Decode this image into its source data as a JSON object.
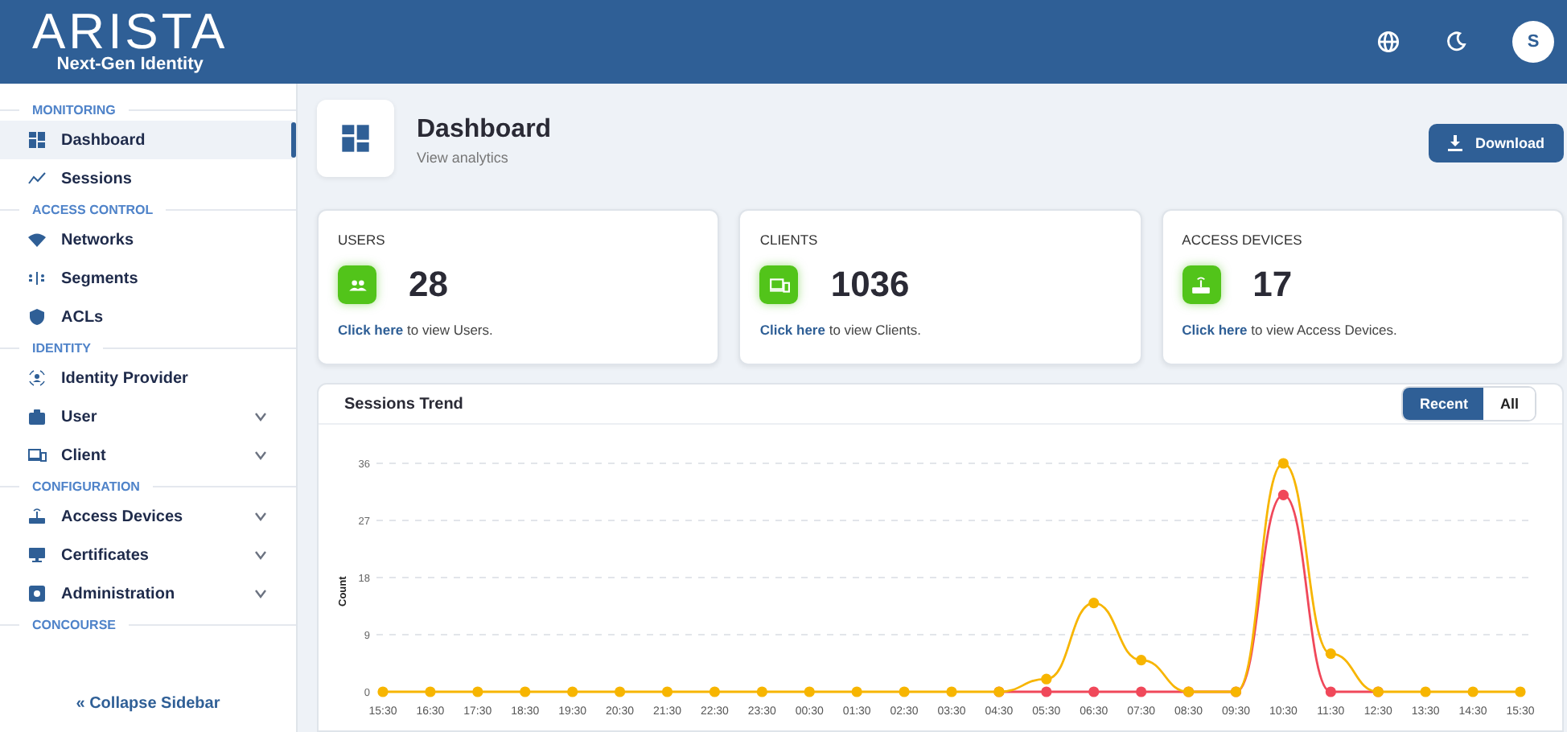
{
  "header": {
    "logo": "ARISTA",
    "tagline": "Next-Gen Identity",
    "avatar": "S"
  },
  "sidebar": {
    "sections": [
      {
        "title": "MONITORING",
        "items": [
          {
            "label": "Dashboard",
            "selected": true
          },
          {
            "label": "Sessions",
            "selected": false
          }
        ]
      },
      {
        "title": "ACCESS CONTROL",
        "items": [
          {
            "label": "Networks",
            "selected": false
          },
          {
            "label": "Segments",
            "selected": false
          },
          {
            "label": "ACLs",
            "selected": false
          }
        ]
      },
      {
        "title": "IDENTITY",
        "items": [
          {
            "label": "Identity Provider",
            "selected": false
          },
          {
            "label": "User",
            "selected": false,
            "expanded": false
          },
          {
            "label": "Client",
            "selected": false,
            "expanded": false
          }
        ]
      },
      {
        "title": "CONFIGURATION",
        "items": [
          {
            "label": "Access Devices",
            "selected": false,
            "expanded": false
          },
          {
            "label": "Certificates",
            "selected": false,
            "expanded": false
          },
          {
            "label": "Administration",
            "selected": false,
            "expanded": false
          }
        ]
      },
      {
        "title": "CONCOURSE"
      }
    ],
    "collapse": {
      "label": "« Collapse Sidebar"
    }
  },
  "page": {
    "title": "Dashboard",
    "subtitle": "View analytics",
    "download": "Download"
  },
  "cards": [
    {
      "title": "USERS",
      "value": "28",
      "link": "Click here",
      "text": " to view Users."
    },
    {
      "title": "CLIENTS",
      "value": "1036",
      "link": "Click here",
      "text": " to view Clients."
    },
    {
      "title": "ACCESS DEVICES",
      "value": "17",
      "link": "Click here",
      "text": " to view Access Devices."
    }
  ],
  "trend": {
    "title": "Sessions Trend",
    "filters": [
      {
        "label": "Recent",
        "selected": true
      },
      {
        "label": "All",
        "selected": false
      }
    ],
    "chart_data": {
      "type": "line",
      "ylabel": "Count",
      "grid": true,
      "categories": [
        "15:30",
        "16:30",
        "17:30",
        "18:30",
        "19:30",
        "20:30",
        "21:30",
        "22:30",
        "23:30",
        "00:30",
        "01:30",
        "02:30",
        "03:30",
        "04:30",
        "05:30",
        "06:30",
        "07:30",
        "08:30",
        "09:30",
        "10:30",
        "11:30",
        "12:30",
        "13:30",
        "14:30",
        "15:30"
      ],
      "ylim": [
        0,
        36
      ],
      "yticks": [
        0,
        9,
        18,
        27,
        36
      ],
      "series": [
        {
          "color": "#f0485a",
          "marker": "circle",
          "values": [
            null,
            null,
            null,
            null,
            null,
            null,
            null,
            null,
            null,
            null,
            null,
            null,
            null,
            0,
            0,
            0,
            0,
            0,
            0,
            31,
            0,
            0,
            null,
            null,
            null
          ]
        },
        {
          "color": "#f7b500",
          "marker": "circle",
          "values": [
            0,
            0,
            0,
            0,
            0,
            0,
            0,
            0,
            0,
            0,
            0,
            0,
            0,
            0,
            2,
            14,
            5,
            0,
            0,
            36,
            6,
            0,
            0,
            0,
            0
          ]
        }
      ]
    }
  }
}
